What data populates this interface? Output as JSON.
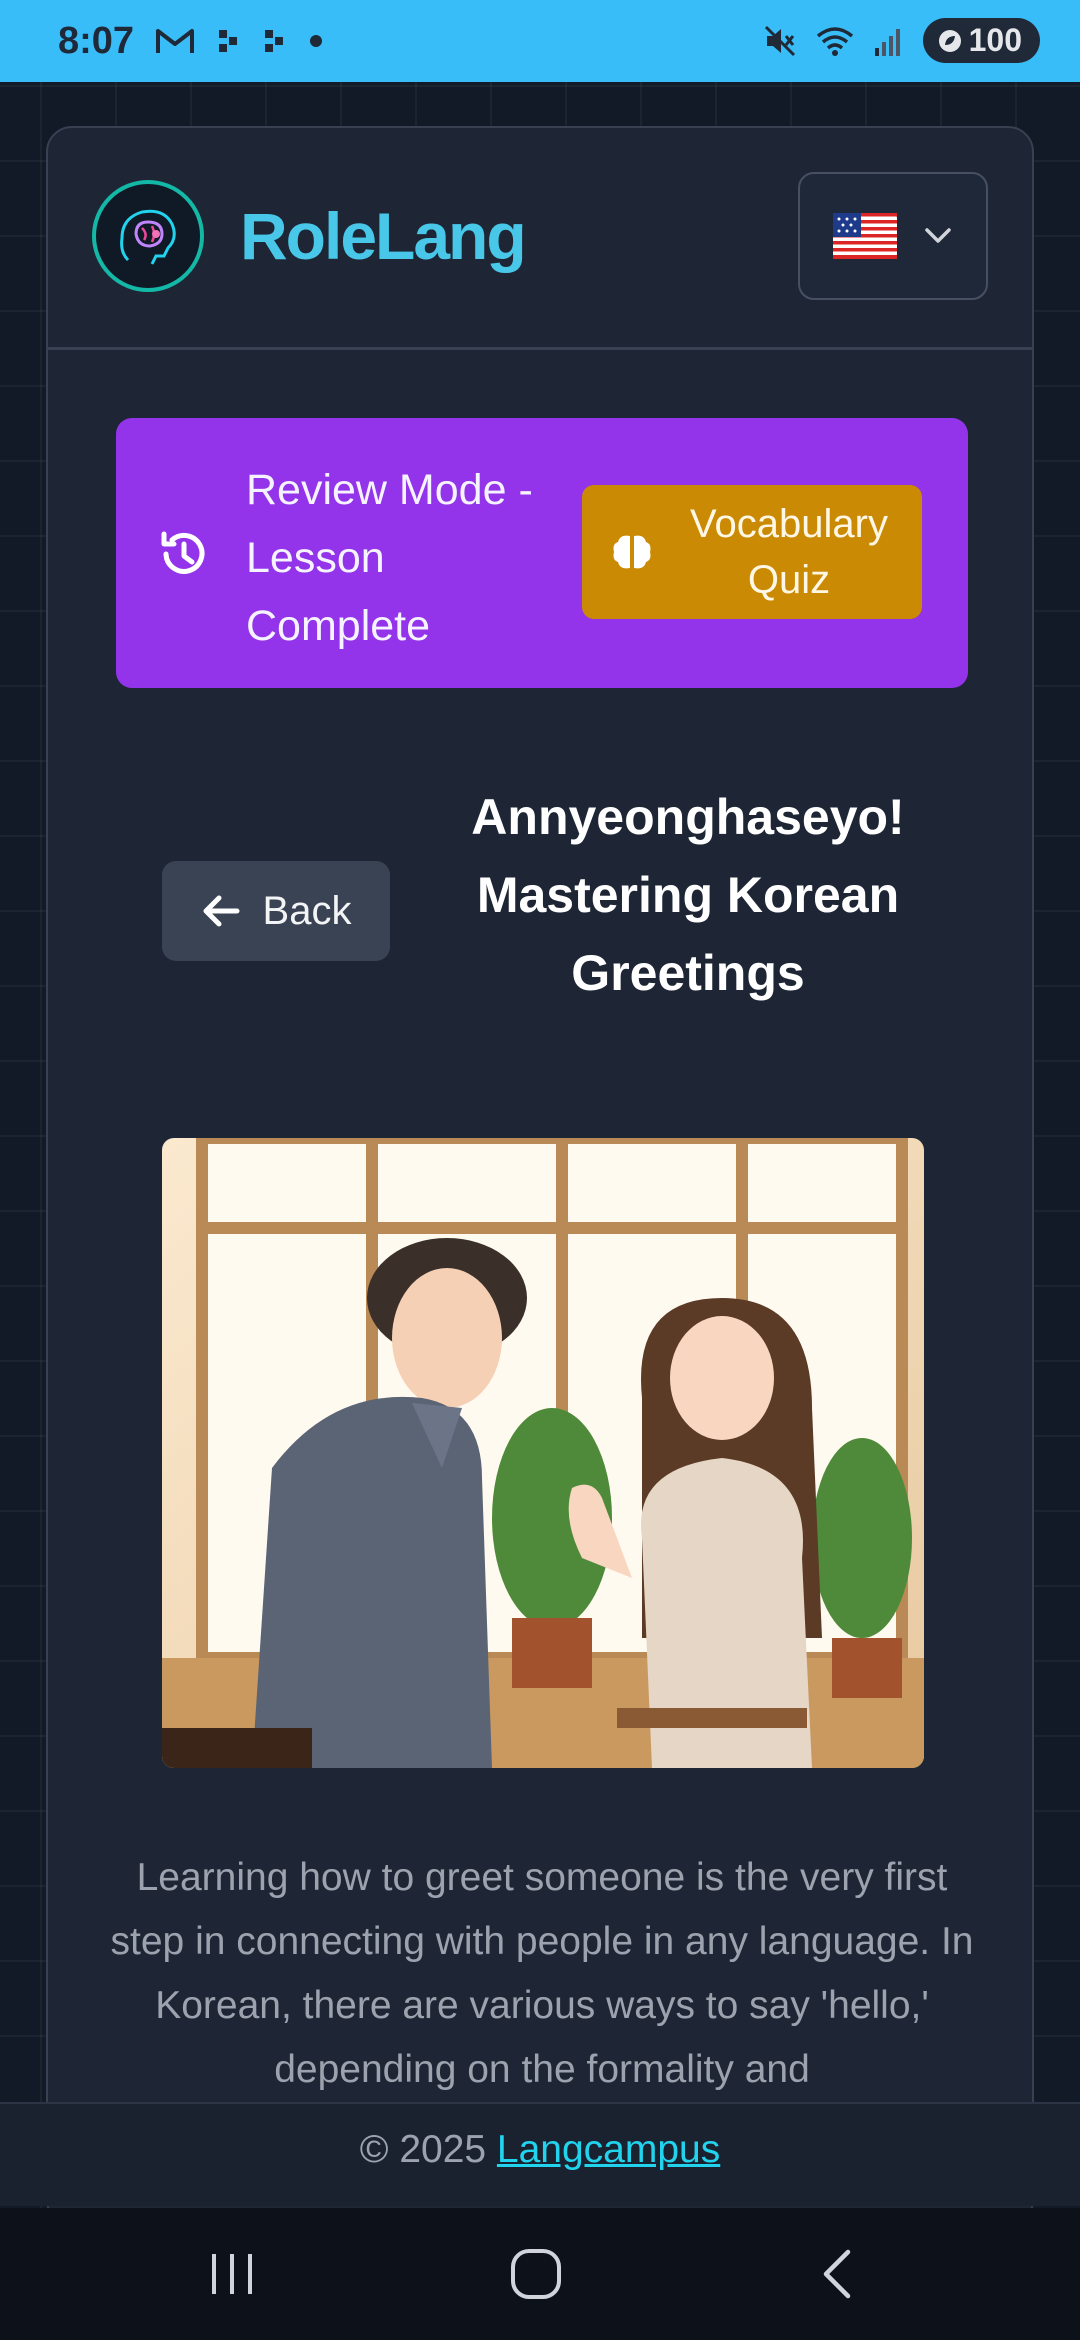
{
  "status_bar": {
    "time": "8:07",
    "battery": "100"
  },
  "header": {
    "brand": "RoleLang",
    "language_flag": "🇺🇸"
  },
  "review_banner": {
    "label": "Review Mode - Lesson Complete",
    "quiz_button_label": "Vocabulary Quiz"
  },
  "lesson": {
    "back_label": "Back",
    "title": "Annyeonghaseyo! Mastering Korean Greetings",
    "intro": "Learning how to greet someone is the very first step in connecting with people in any language. In Korean, there are various ways to say 'hello,' depending on the formality and"
  },
  "footer": {
    "copyright": "© 2025",
    "link_label": "Langcampus"
  },
  "colors": {
    "accent": "#38bdf8",
    "review_banner": "#9333ea",
    "quiz_button": "#ca8a04",
    "brand": "#48c7e8"
  }
}
